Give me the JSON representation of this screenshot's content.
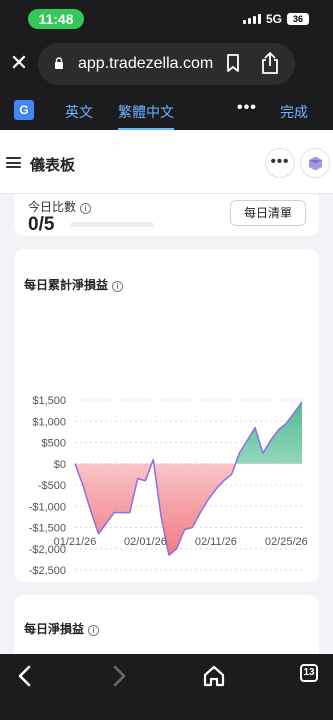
{
  "status": {
    "time": "11:48",
    "network": "5G",
    "battery": "36"
  },
  "browser": {
    "url": "app.tradezella.com",
    "tab_count": "13"
  },
  "translate": {
    "icon_text": "G",
    "source_lang": "英文",
    "target_lang": "繁體中文",
    "more": "•••",
    "done": "完成"
  },
  "app": {
    "title": "儀表板",
    "more": "•••"
  },
  "daily_ratio": {
    "label": "今日比數",
    "value": "0/5",
    "button": "每日清單"
  },
  "cumulative_card": {
    "title": "每日累計淨損益"
  },
  "daily_card": {
    "title": "每日淨損益"
  },
  "colors": {
    "positive_fill": "#48b98e",
    "negative_fill": "#f06b73",
    "line": "#8c6ee6"
  },
  "chart_data": {
    "type": "area",
    "title": "每日累計淨損益",
    "ytick_labels": [
      "$1,500",
      "$1,000",
      "$500",
      "$0",
      "-$500",
      "-$1,000",
      "-$1,500",
      "-$2,000",
      "-$2,500"
    ],
    "yticks": [
      1500,
      1000,
      500,
      0,
      -500,
      -1000,
      -1500,
      -2000,
      -2500
    ],
    "ylim": [
      -2500,
      1500
    ],
    "xtick_labels": [
      "01/21/26",
      "02/01/26",
      "02/11/26",
      "02/25/26"
    ],
    "grid": true,
    "series": [
      {
        "values": [
          0,
          -500,
          -1100,
          -1650,
          -1400,
          -1150,
          -1150,
          -1150,
          -350,
          -400,
          100,
          -1250,
          -2150,
          -2000,
          -1550,
          -1500,
          -1150,
          -850,
          -600,
          -400,
          -250,
          250,
          550,
          850,
          250,
          550,
          800,
          950,
          1200,
          1450
        ]
      }
    ],
    "xtick_indices": [
      0,
      9,
      18,
      27
    ]
  }
}
